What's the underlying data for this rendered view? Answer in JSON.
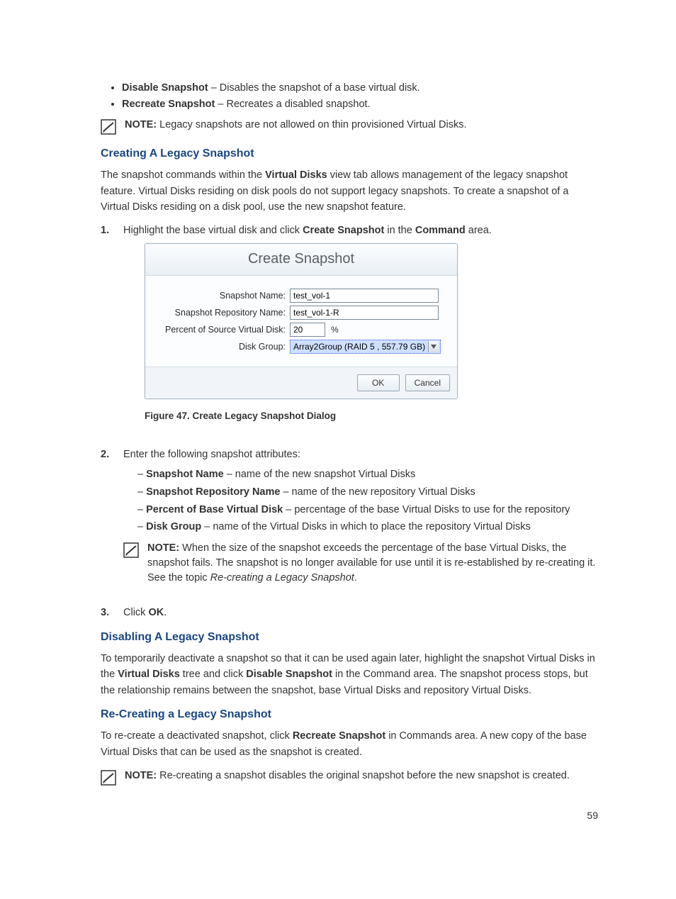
{
  "pageNumber": "59",
  "topBullets": [
    {
      "term": "Disable Snapshot",
      "desc": " – Disables the snapshot of a base virtual disk."
    },
    {
      "term": "Recreate Snapshot",
      "desc": " – Recreates a disabled snapshot."
    }
  ],
  "note1": {
    "label": "NOTE:",
    "text": " Legacy snapshots are not allowed on thin provisioned Virtual Disks."
  },
  "sectionCreate": {
    "title": "Creating A Legacy Snapshot",
    "para_before": "The snapshot commands within the ",
    "para_bold1": "Virtual Disks",
    "para_after": " view tab allows management of the legacy snapshot feature. Virtual Disks residing on disk pools do not support legacy snapshots. To create a snapshot of a Virtual Disks residing on a disk pool, use the new snapshot feature."
  },
  "step1": {
    "num": "1.",
    "t1": "Highlight the base virtual disk and click ",
    "b1": "Create Snapshot",
    "t2": " in the ",
    "b2": "Command",
    "t3": " area."
  },
  "dialog": {
    "title": "Create Snapshot",
    "rows": {
      "snap_lbl": "Snapshot Name:",
      "snap_val": "test_vol-1",
      "repo_lbl": "Snapshot Repository Name:",
      "repo_val": "test_vol-1-R",
      "pct_lbl": "Percent of Source Virtual Disk:",
      "pct_val": "20",
      "pct_sym": "%",
      "dg_lbl": "Disk Group:",
      "dg_val": "Array2Group (RAID 5 , 557.79 GB)"
    },
    "ok": "OK",
    "cancel": "Cancel"
  },
  "figureCaption": "Figure 47. Create Legacy Snapshot Dialog",
  "step2": {
    "num": "2.",
    "intro": "Enter the following snapshot attributes:",
    "attrs": [
      {
        "term": "Snapshot Name",
        "desc": " – name of the new snapshot Virtual Disks"
      },
      {
        "term": "Snapshot Repository Name",
        "desc": " – name of the new repository Virtual Disks"
      },
      {
        "term": "Percent of Base Virtual Disk",
        "desc": " – percentage of the base Virtual Disks to use for the repository"
      },
      {
        "term": "Disk Group",
        "desc": " – name of the Virtual Disks in which to place the repository Virtual Disks"
      }
    ],
    "note": {
      "label": "NOTE:",
      "t1": " When the size of the snapshot exceeds the percentage of the base Virtual Disks, the snapshot fails. The snapshot is no longer available for use until it is re-established by re-creating it. See the topic ",
      "italic": "Re-creating a Legacy Snapshot",
      "t2": "."
    }
  },
  "step3": {
    "num": "3.",
    "t1": "Click ",
    "b1": "OK",
    "t2": "."
  },
  "sectionDisable": {
    "title": "Disabling A Legacy Snapshot",
    "p_a": "To temporarily deactivate a snapshot so that it can be used again later, highlight the snapshot Virtual Disks in the ",
    "p_b1": "Virtual Disks",
    "p_b": " tree and click ",
    "p_b2": "Disable Snapshot",
    "p_c": " in the Command area. The snapshot process stops, but the relationship remains between the snapshot, base Virtual Disks and repository Virtual Disks."
  },
  "sectionRecreate": {
    "title": "Re-Creating a Legacy Snapshot",
    "p_a": "To re-create a deactivated snapshot, click ",
    "p_b1": "Recreate Snapshot",
    "p_b": " in Commands area. A new copy of the base Virtual Disks that can be used as the snapshot is created."
  },
  "note3": {
    "label": "NOTE:",
    "text": " Re-creating a snapshot disables the original snapshot before the new snapshot is created."
  }
}
